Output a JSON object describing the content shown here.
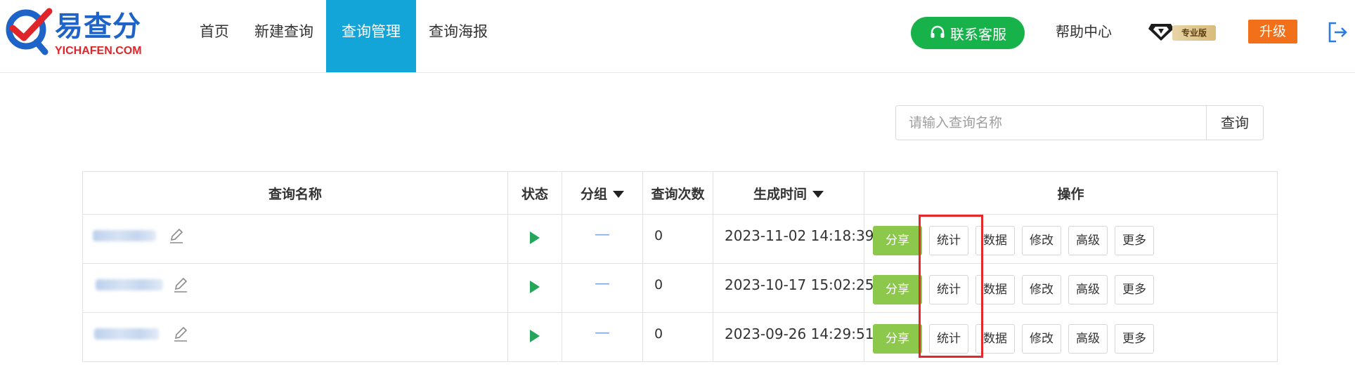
{
  "header": {
    "logo_text": "易查分",
    "logo_sub": "YICHAFEN.COM",
    "nav": [
      {
        "label": "首页",
        "active": false
      },
      {
        "label": "新建查询",
        "active": false
      },
      {
        "label": "查询管理",
        "active": true
      },
      {
        "label": "查询海报",
        "active": false
      }
    ],
    "contact_label": "联系客服",
    "help_label": "帮助中心",
    "vip_label": "专业版",
    "upgrade_label": "升级"
  },
  "search": {
    "placeholder": "请输入查询名称",
    "button_label": "查询"
  },
  "table": {
    "headers": {
      "name": "查询名称",
      "status": "状态",
      "group": "分组",
      "count": "查询次数",
      "time": "生成时间",
      "ops": "操作"
    },
    "rows": [
      {
        "group": "—",
        "count": "0",
        "time": "2023-11-02 14:18:39"
      },
      {
        "group": "—",
        "count": "0",
        "time": "2023-10-17 15:02:25"
      },
      {
        "group": "—",
        "count": "0",
        "time": "2023-09-26 14:29:51"
      }
    ],
    "actions": {
      "share": "分享",
      "stats": "统计",
      "data": "数据",
      "edit": "修改",
      "advanced": "高级",
      "more": "更多"
    }
  },
  "colors": {
    "nav_active": "#13a4d8",
    "contact_green": "#18b24b",
    "upgrade_orange": "#f3701a",
    "share_green": "#8cc84b",
    "highlight_red": "#e5282a"
  }
}
